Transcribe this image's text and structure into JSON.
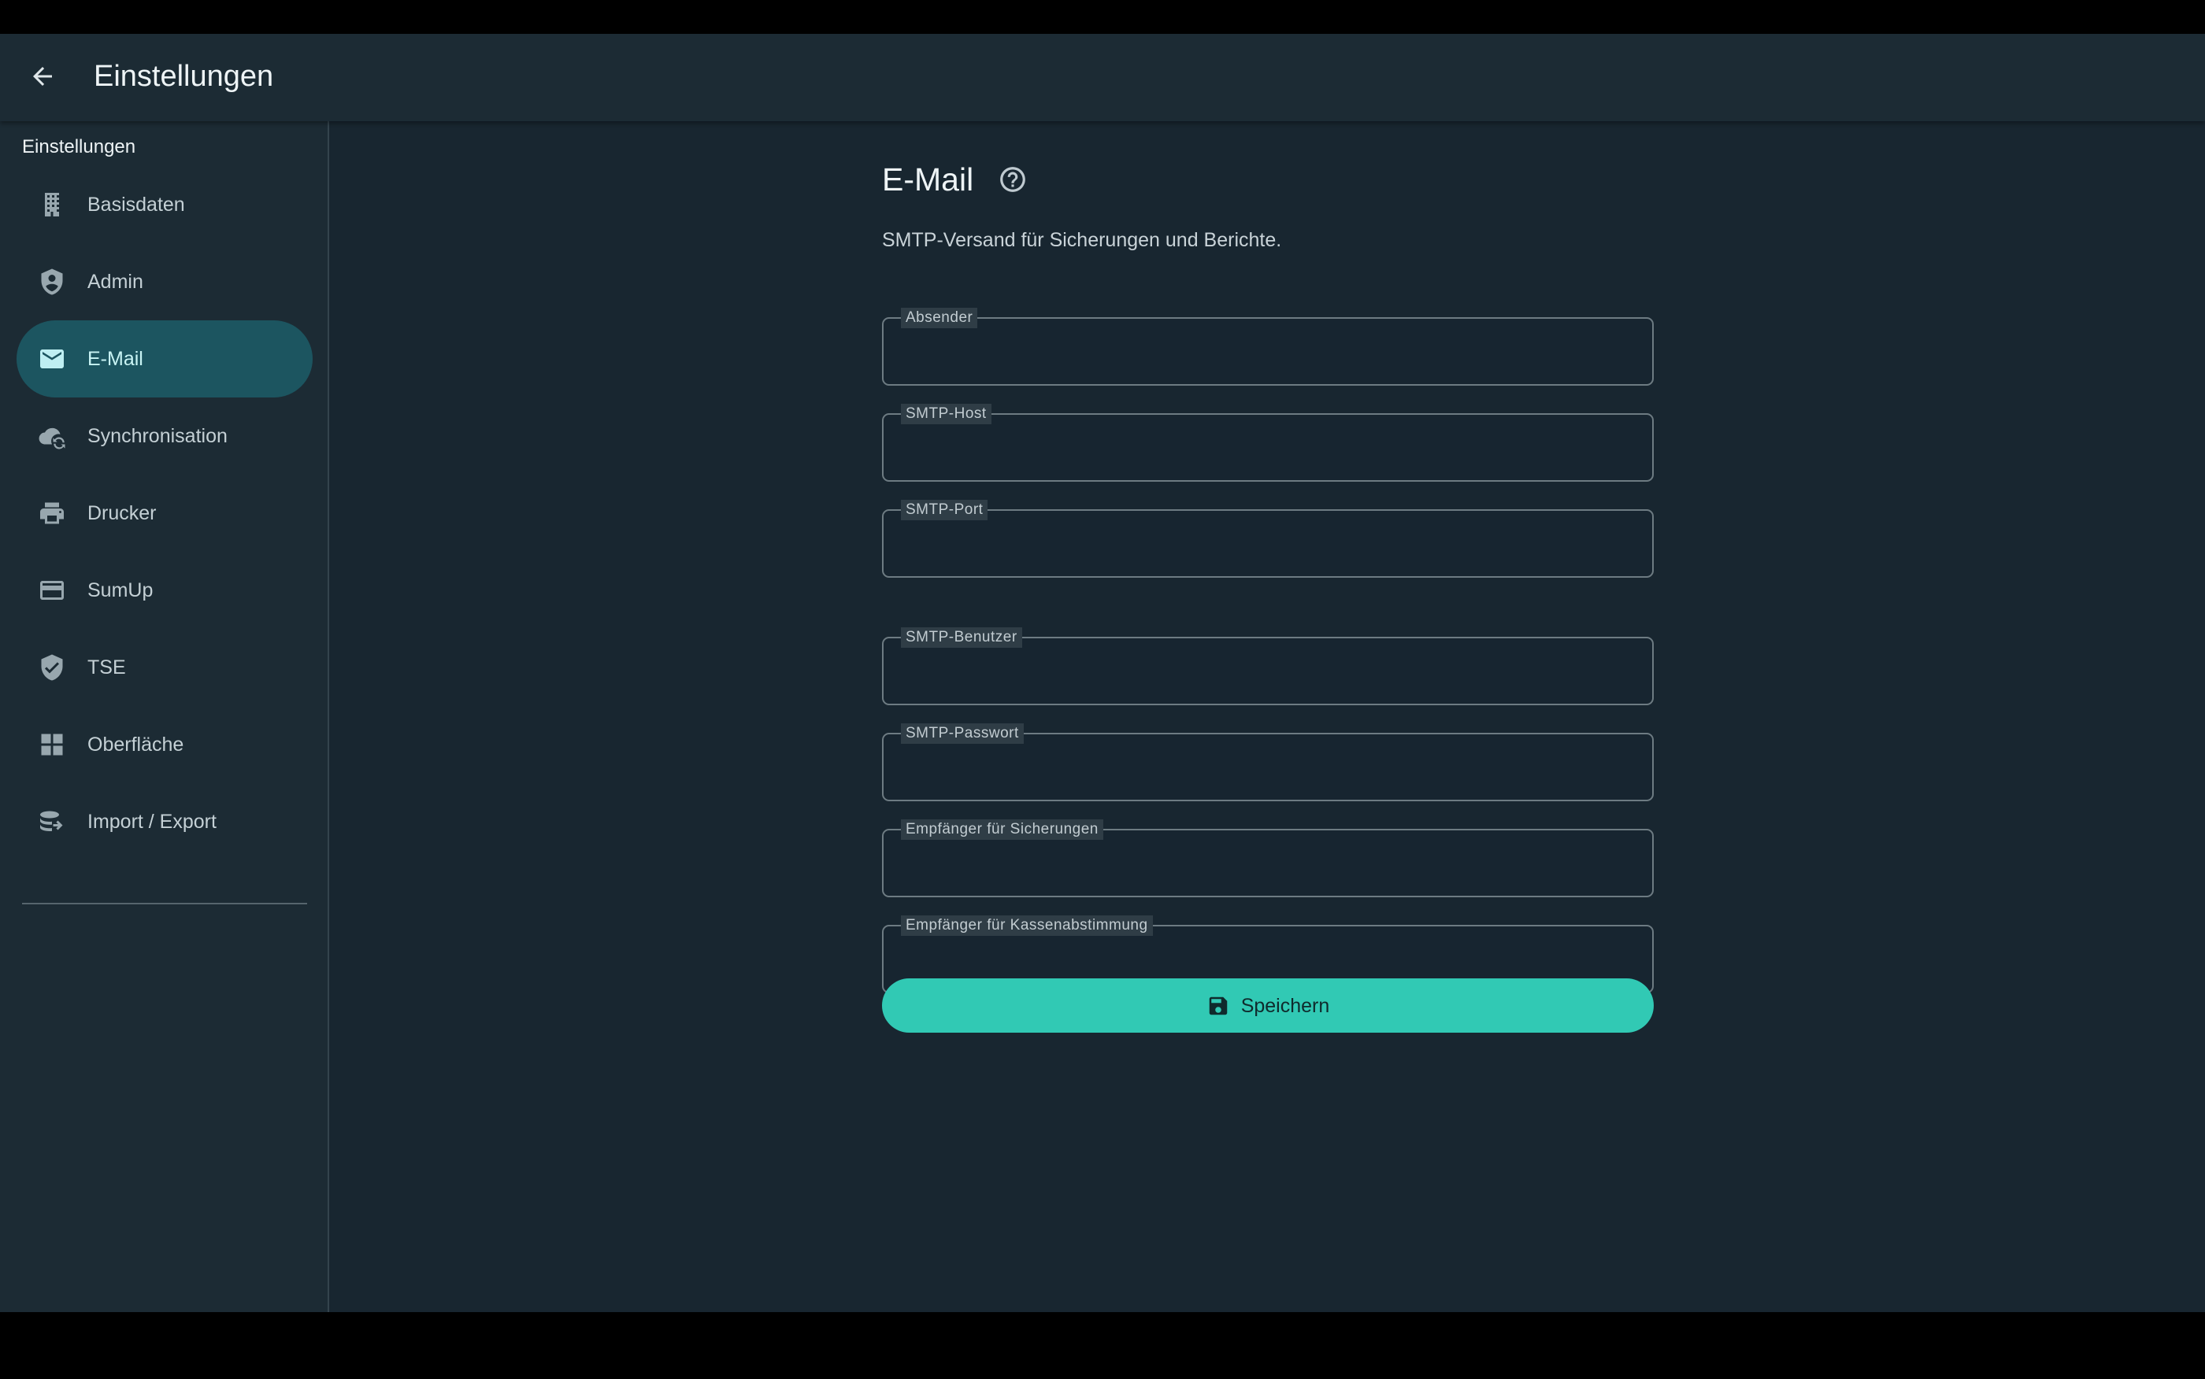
{
  "header": {
    "title": "Einstellungen",
    "back_icon": "arrow-back-icon"
  },
  "sidebar": {
    "heading": "Einstellungen",
    "items": [
      {
        "label": "Basisdaten",
        "icon": "building-icon",
        "active": false
      },
      {
        "label": "Admin",
        "icon": "admin-shield-icon",
        "active": false
      },
      {
        "label": "E-Mail",
        "icon": "mail-icon",
        "active": true
      },
      {
        "label": "Synchronisation",
        "icon": "cloud-sync-icon",
        "active": false
      },
      {
        "label": "Drucker",
        "icon": "printer-icon",
        "active": false
      },
      {
        "label": "SumUp",
        "icon": "credit-card-icon",
        "active": false
      },
      {
        "label": "TSE",
        "icon": "verified-shield-icon",
        "active": false
      },
      {
        "label": "Oberfläche",
        "icon": "dashboard-icon",
        "active": false
      },
      {
        "label": "Import / Export",
        "icon": "database-export-icon",
        "active": false
      }
    ]
  },
  "main": {
    "title": "E-Mail",
    "help_icon": "help-circle-icon",
    "description": "SMTP-Versand für Sicherungen und Berichte.",
    "fields": [
      {
        "label": "Absender",
        "value": ""
      },
      {
        "label": "SMTP-Host",
        "value": ""
      },
      {
        "label": "SMTP-Port",
        "value": ""
      },
      {
        "label": "SMTP-Benutzer",
        "value": ""
      },
      {
        "label": "SMTP-Passwort",
        "value": ""
      },
      {
        "label": "Empfänger für Sicherungen",
        "value": ""
      },
      {
        "label": "Empfänger für Kassenabstimmung",
        "value": ""
      }
    ],
    "save_button": {
      "label": "Speichern",
      "icon": "save-icon"
    }
  },
  "colors": {
    "accent": "#31c9b4",
    "active_nav_bg": "#1c5560",
    "background": "#182630",
    "surface": "#1c2b34"
  }
}
